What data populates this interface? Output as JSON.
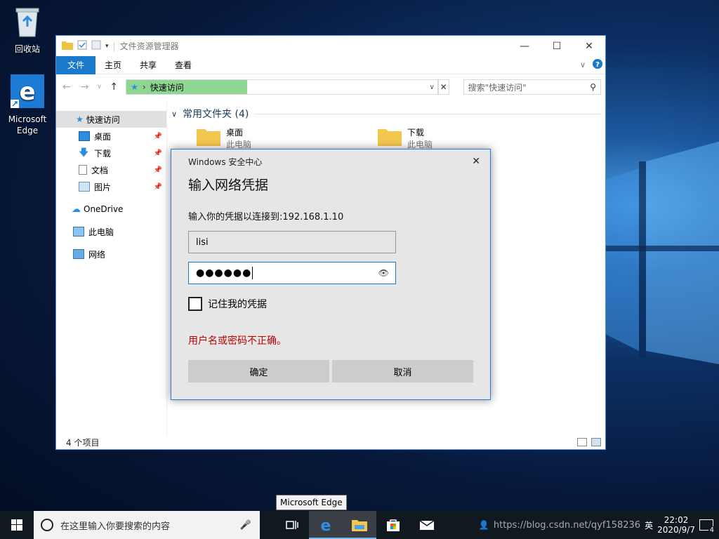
{
  "desktop": {
    "recycle_bin_label": "回收站",
    "edge_label_line1": "Microsoft",
    "edge_label_line2": "Edge"
  },
  "explorer": {
    "title": "文件资源管理器",
    "ribbon_tabs": [
      "文件",
      "主页",
      "共享",
      "查看"
    ],
    "address_path": "快速访问",
    "search_placeholder": "搜索\"快速访问\"",
    "sidebar": {
      "quick_access": "快速访问",
      "items": [
        "桌面",
        "下载",
        "文档",
        "图片"
      ],
      "onedrive": "OneDrive",
      "this_pc": "此电脑",
      "network": "网络"
    },
    "group_header": "常用文件夹 (4)",
    "folders": [
      {
        "name": "桌面",
        "location": "此电脑"
      },
      {
        "name": "下载",
        "location": "此电脑"
      }
    ],
    "status_text": "4 个项目"
  },
  "dialog": {
    "header": "Windows 安全中心",
    "title": "输入网络凭据",
    "subtitle": "输入你的凭据以连接到:192.168.1.10",
    "username_value": "lisi",
    "password_mask": "●●●●●●",
    "remember_label": "记住我的凭据",
    "error_text": "用户名或密码不正确。",
    "ok_label": "确定",
    "cancel_label": "取消"
  },
  "tooltip": "Microsoft Edge",
  "taskbar": {
    "search_placeholder": "在这里输入你要搜索的内容",
    "ime_label": "英",
    "time": "22:02",
    "date": "2020/9/7",
    "watermark": "https://blog.csdn.net/qyf158236",
    "notification_count": "4"
  },
  "colors": {
    "accent": "#1979ca",
    "error": "#c00000",
    "address_highlight": "#8fd694"
  }
}
